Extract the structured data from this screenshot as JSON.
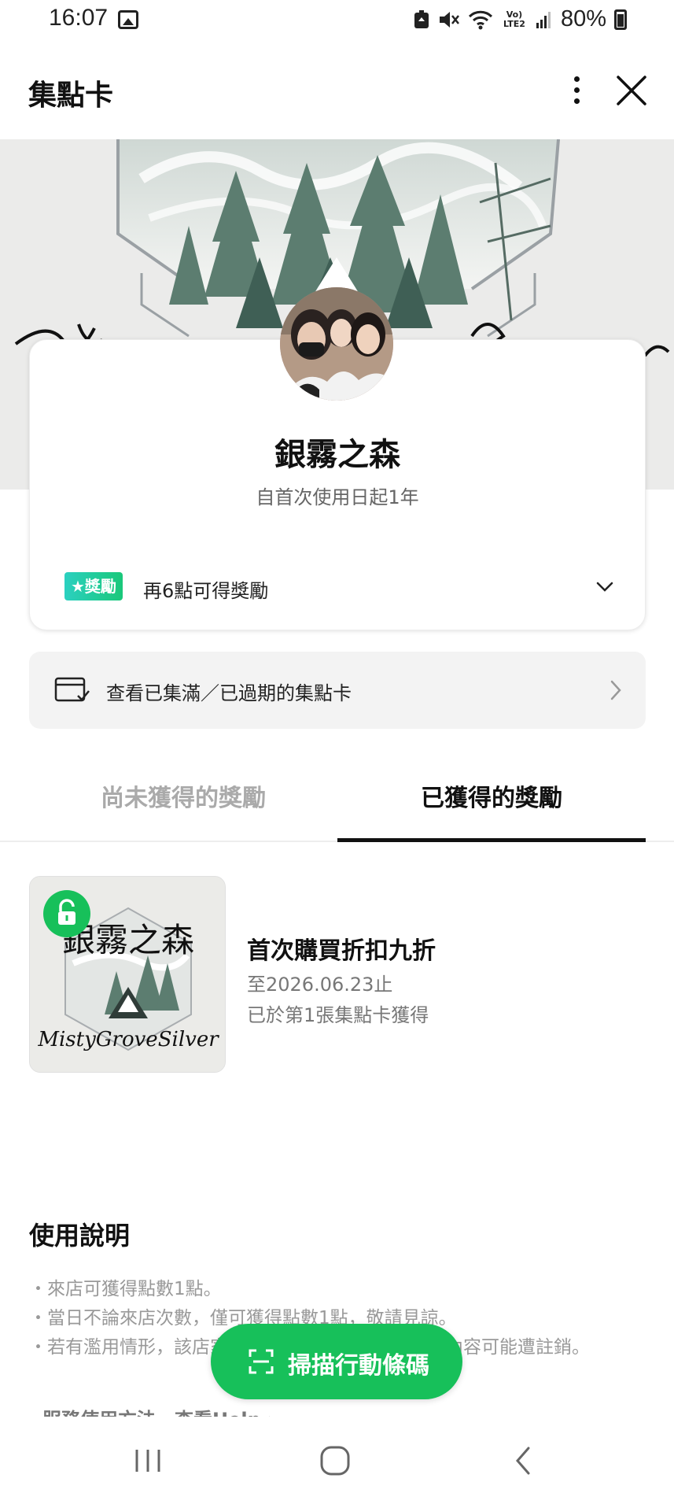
{
  "status": {
    "time": "16:07",
    "battery": "80%",
    "network_label": "Vo) LTE2"
  },
  "header": {
    "title": "集點卡"
  },
  "card": {
    "store_name": "銀霧之森",
    "validity": "自首次使用日起1年",
    "reward_badge": "★獎勵",
    "reward_hint": "再6點可得獎勵"
  },
  "expired_link": {
    "label": "查看已集滿／已過期的集點卡"
  },
  "tabs": [
    {
      "label": "尚未獲得的獎勵",
      "active": false
    },
    {
      "label": "已獲得的獎勵",
      "active": true
    }
  ],
  "rewards": [
    {
      "title": "首次購買折扣九折",
      "expiry": "至2026.06.23止",
      "origin": "已於第1張集點卡獲得",
      "thumb_logo_text": "銀霧之森",
      "thumb_script_text": "MistyGroveSilver"
    }
  ],
  "instructions": {
    "title": "使用說明",
    "lines": [
      "・來店可獲得點數1點。",
      "・當日不論來店次數，僅可獲得點數1點，敬請見諒。",
      "・若有濫用情形，該店家所贈予之點數與獎勵等所有內容可能遭註銷。"
    ],
    "link": "服務使用方法・查看Help"
  },
  "scan_button": {
    "label": "掃描行動條碼"
  },
  "colors": {
    "brand_green": "#17c05a",
    "badge_teal": "#2bd0c0",
    "muted_text": "#777777"
  }
}
